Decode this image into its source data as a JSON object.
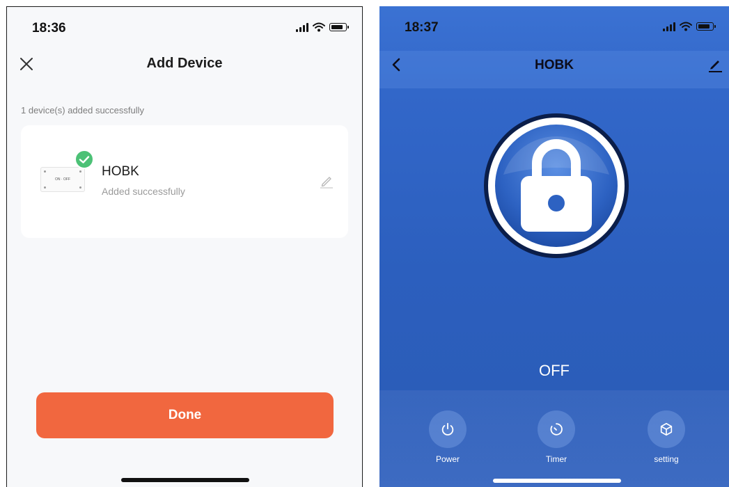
{
  "left_screen": {
    "status_time": "18:36",
    "title": "Add Device",
    "added_note": "1 device(s) added successfully",
    "device": {
      "thumb_label": "ON · OFF",
      "name": "HOBK",
      "status": "Added successfully"
    },
    "done_label": "Done"
  },
  "right_screen": {
    "status_time": "18:37",
    "title": "HOBK",
    "state": "OFF",
    "controls": [
      {
        "label": "Power",
        "icon": "power-icon"
      },
      {
        "label": "Timer",
        "icon": "timer-icon"
      },
      {
        "label": "setting",
        "icon": "cube-icon"
      }
    ]
  },
  "colors": {
    "accent_orange": "#f1673f",
    "success_green": "#4cc176",
    "panel_blue": "#2c5fbe"
  }
}
